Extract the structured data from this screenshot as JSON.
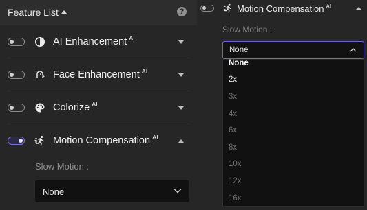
{
  "left_panel": {
    "header": {
      "title": "Feature List"
    },
    "features": [
      {
        "label": "AI Enhancement",
        "badge": "AI",
        "enabled": false,
        "expanded": false,
        "icon": "contrast-circle-icon"
      },
      {
        "label": "Face Enhancement",
        "badge": "AI",
        "enabled": false,
        "expanded": false,
        "icon": "face-sparkle-icon"
      },
      {
        "label": "Colorize",
        "badge": "AI",
        "enabled": false,
        "expanded": false,
        "icon": "palette-icon"
      },
      {
        "label": "Motion Compensation",
        "badge": "AI",
        "enabled": true,
        "expanded": true,
        "icon": "running-person-icon"
      }
    ],
    "slow_motion": {
      "label": "Slow Motion :",
      "selected": "None"
    }
  },
  "right_panel": {
    "feature": {
      "label": "Motion Compensation",
      "badge": "AI",
      "enabled": false,
      "icon": "running-person-icon"
    },
    "slow_motion": {
      "label": "Slow Motion :",
      "selected": "None",
      "options": [
        {
          "label": "None",
          "state": "selected"
        },
        {
          "label": "2x",
          "state": "enabled"
        },
        {
          "label": "3x",
          "state": "disabled"
        },
        {
          "label": "4x",
          "state": "disabled"
        },
        {
          "label": "6x",
          "state": "disabled"
        },
        {
          "label": "8x",
          "state": "disabled"
        },
        {
          "label": "10x",
          "state": "disabled"
        },
        {
          "label": "12x",
          "state": "disabled"
        },
        {
          "label": "16x",
          "state": "disabled"
        }
      ]
    }
  },
  "colors": {
    "background": "#262626",
    "header_bg": "#2d2d2d",
    "accent": "#7b6cf0",
    "dropdown_bg": "#111111",
    "disabled_text": "#6f6f6f"
  }
}
